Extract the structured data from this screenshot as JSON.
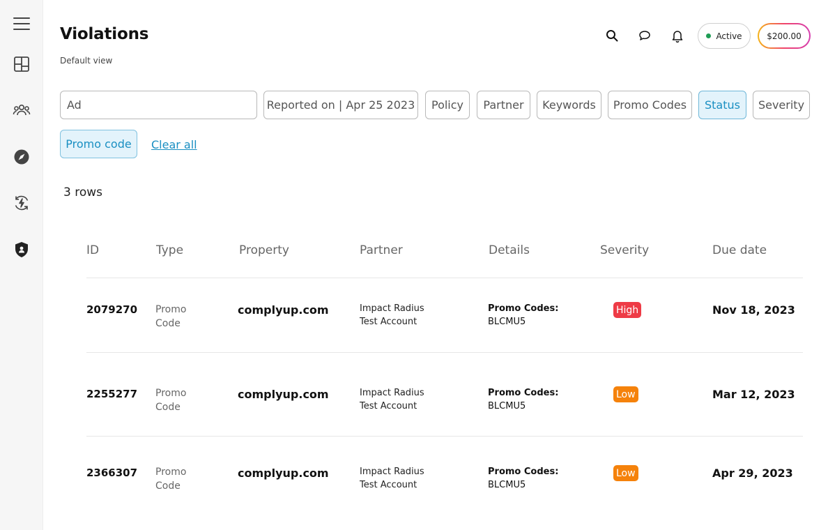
{
  "header": {
    "title": "Violations",
    "view": "Default view",
    "status_label": "Active",
    "status_color": "#1f9d55",
    "balance": "$200.00"
  },
  "sidebar": {
    "items": [
      {
        "name": "menu-icon"
      },
      {
        "name": "dashboard-icon"
      },
      {
        "name": "partners-icon"
      },
      {
        "name": "discover-icon"
      },
      {
        "name": "automation-icon"
      },
      {
        "name": "compliance-shield-icon",
        "active": true
      }
    ]
  },
  "filters": {
    "ad_placeholder": "Ad",
    "reported_on": "Reported on |  Apr 25 2023",
    "policy": "Policy",
    "partner": "Partner",
    "keywords": "Keywords",
    "promo_codes": "Promo Codes",
    "status": "Status",
    "severity": "Severity"
  },
  "applied": {
    "chip": "Promo code",
    "clear_all": "Clear all"
  },
  "table": {
    "row_count": "3 rows",
    "columns": [
      "ID",
      "Type",
      "Property",
      "Partner",
      "Details",
      "Severity",
      "Due date"
    ],
    "rows": [
      {
        "id": "2079270",
        "type_1": "Promo",
        "type_2": "Code",
        "property": "complyup.com",
        "partner_1": "Impact Radius",
        "partner_2": "Test Account",
        "details_label": "Promo Codes:",
        "details_value": "BLCMU5",
        "severity": "High",
        "due": "Nov 18, 2023"
      },
      {
        "id": "2255277",
        "type_1": "Promo",
        "type_2": "Code",
        "property": "complyup.com",
        "partner_1": "Impact Radius",
        "partner_2": "Test Account",
        "details_label": "Promo Codes:",
        "details_value": "BLCMU5",
        "severity": "Low",
        "due": "Mar 12, 2023"
      },
      {
        "id": "2366307",
        "type_1": "Promo",
        "type_2": "Code",
        "property": "complyup.com",
        "partner_1": "Impact Radius",
        "partner_2": "Test Account",
        "details_label": "Promo Codes:",
        "details_value": "BLCMU5",
        "severity": "Low",
        "due": "Apr 29, 2023"
      }
    ]
  },
  "colors": {
    "accent": "#1a8fc2",
    "severity_high": "#ee3b46",
    "severity_low": "#f5820b"
  }
}
